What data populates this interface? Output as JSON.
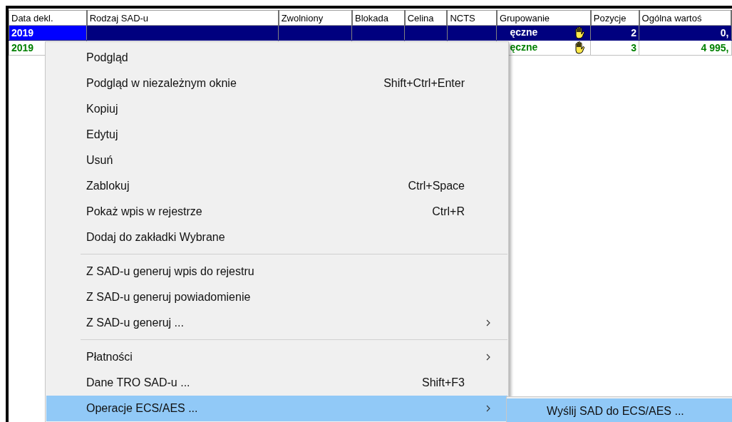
{
  "table": {
    "columns": [
      "Data dekl.",
      "Rodzaj SAD-u",
      "Zwolniony",
      "Blokada",
      "Celina",
      "NCTS",
      "Grupowanie",
      "Pozycje",
      "Ogólna wartoś"
    ],
    "rows": [
      {
        "selected": true,
        "color": "#ffffff",
        "date": "2019",
        "grouping": "ęczne",
        "positions": "2",
        "value": "0,"
      },
      {
        "selected": false,
        "color": "#008000",
        "date": "2019",
        "grouping": "ęczne",
        "positions": "3",
        "value": "4 995,"
      }
    ]
  },
  "context_menu": {
    "items": [
      {
        "kind": "item",
        "label": "Podgląd",
        "selected": false,
        "submenu": false
      },
      {
        "kind": "item",
        "label": "Podgląd w niezależnym oknie",
        "shortcut": "Shift+Ctrl+Enter",
        "selected": false,
        "submenu": false
      },
      {
        "kind": "item",
        "label": "Kopiuj",
        "selected": false,
        "submenu": false
      },
      {
        "kind": "item",
        "label": "Edytuj",
        "selected": false,
        "submenu": false
      },
      {
        "kind": "item",
        "label": "Usuń",
        "selected": false,
        "submenu": false
      },
      {
        "kind": "item",
        "label": "Zablokuj",
        "shortcut": "Ctrl+Space",
        "selected": false,
        "submenu": false
      },
      {
        "kind": "item",
        "label": "Pokaż wpis w rejestrze",
        "shortcut": "Ctrl+R",
        "selected": false,
        "submenu": false
      },
      {
        "kind": "item",
        "label": "Dodaj do zakładki Wybrane",
        "selected": false,
        "submenu": false
      },
      {
        "kind": "separator"
      },
      {
        "kind": "item",
        "label": "Z SAD-u generuj wpis do rejestru",
        "selected": false,
        "submenu": false
      },
      {
        "kind": "item",
        "label": "Z SAD-u generuj powiadomienie",
        "selected": false,
        "submenu": false
      },
      {
        "kind": "item",
        "label": "Z SAD-u generuj ...",
        "selected": false,
        "submenu": true
      },
      {
        "kind": "separator"
      },
      {
        "kind": "item",
        "label": "Płatności",
        "selected": false,
        "submenu": true
      },
      {
        "kind": "item",
        "label": "Dane TRO SAD-u ...",
        "shortcut": "Shift+F3",
        "selected": false,
        "submenu": false
      },
      {
        "kind": "item",
        "label": "Operacje ECS/AES ...",
        "selected": true,
        "submenu": true
      }
    ]
  },
  "submenu": {
    "items": [
      {
        "label": "Wyślij SAD do ECS/AES ...",
        "selected": true
      }
    ]
  }
}
